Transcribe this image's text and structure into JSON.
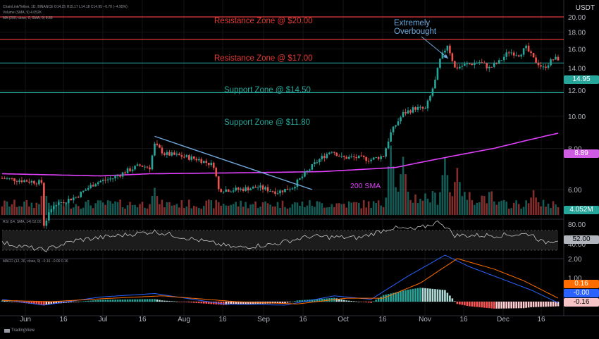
{
  "header": {
    "symbol_line": "ChainLink/Tether, 1D, BINANCE  O14.25  H15.17  L14.18  C14.95  −0.70 (−4.95%)",
    "volume_line": "Volume (SMA, 9)  4.052K",
    "ma_line": "MA (200, close, 0, SMA, 9)  8.89",
    "rsi_line": "RSI (14, SMA, 14)  52.00",
    "macd_line": "MACD (12, 26, close, 9)  −0.16  −0.00  0.16"
  },
  "currency": "USDT",
  "annotations": {
    "resistance_20": "Resistance Zone @ $20.00",
    "resistance_17": "Resistance Zone @ $17.00",
    "support_1450": "Support Zone @ $14.50",
    "support_1180": "Support Zone @ $11.80",
    "overbought_line1": "Extremely",
    "overbought_line2": "Overbought",
    "sma_label": "200 SMA"
  },
  "tags": {
    "price": "14.95",
    "sma": "8.89",
    "volume": "4.052M",
    "rsi": "52.00",
    "macd_signal": "0.16",
    "macd_line": "-0.00",
    "macd_hist": "-0.16"
  },
  "branding": "TradingView",
  "colors": {
    "bull": "#26a69a",
    "bear": "#ef5350",
    "resistance": "#e53935",
    "support": "#26a69a",
    "sma": "#e040fb",
    "trendline": "#6fa8dc",
    "macd": "#2962ff",
    "signal": "#ff6d00"
  },
  "chart_data": {
    "type": "candlestick",
    "price_axis": {
      "ticks": [
        "20.00",
        "18.00",
        "16.00",
        "14.00",
        "12.00",
        "10.00",
        "8.00",
        "6.00"
      ],
      "ylim": [
        4.6,
        21.4
      ],
      "scale": "log"
    },
    "time_axis": {
      "ticks": [
        "Jun",
        "16",
        "Jul",
        "16",
        "Aug",
        "16",
        "Sep",
        "16",
        "Oct",
        "16",
        "Nov",
        "16",
        "Dec",
        "16"
      ]
    },
    "rsi_axis": {
      "ticks": [
        "80.00",
        "40.00"
      ]
    },
    "macd_axis": {
      "ticks": [
        "2.00",
        "1.00"
      ]
    },
    "levels": [
      {
        "name": "Resistance Zone @ $20.00",
        "value": 20.0
      },
      {
        "name": "Resistance Zone @ $17.00",
        "value": 17.1
      },
      {
        "name": "Support Zone @ $14.50",
        "value": 14.5
      },
      {
        "name": "Support Zone @ $11.80",
        "value": 11.8
      }
    ],
    "close_path": [
      [
        0,
        6.5
      ],
      [
        8,
        6.4
      ],
      [
        16,
        6.3
      ],
      [
        17,
        4.7
      ],
      [
        21,
        5.4
      ],
      [
        30,
        5.7
      ],
      [
        38,
        6.3
      ],
      [
        45,
        6.5
      ],
      [
        52,
        6.9
      ],
      [
        56,
        7.1
      ],
      [
        60,
        7.0
      ],
      [
        62,
        8.2
      ],
      [
        66,
        7.7
      ],
      [
        72,
        7.6
      ],
      [
        80,
        7.4
      ],
      [
        86,
        7.1
      ],
      [
        88,
        6.0
      ],
      [
        96,
        6.0
      ],
      [
        104,
        6.1
      ],
      [
        112,
        5.9
      ],
      [
        118,
        6.1
      ],
      [
        124,
        6.8
      ],
      [
        128,
        7.3
      ],
      [
        134,
        7.9
      ],
      [
        138,
        7.5
      ],
      [
        144,
        7.5
      ],
      [
        150,
        7.4
      ],
      [
        155,
        7.6
      ],
      [
        158,
        8.9
      ],
      [
        163,
        10.2
      ],
      [
        168,
        10.6
      ],
      [
        172,
        10.5
      ],
      [
        174,
        11.5
      ],
      [
        176,
        12.8
      ],
      [
        178,
        14.8
      ],
      [
        181,
        16.5
      ],
      [
        184,
        14.0
      ],
      [
        188,
        14.3
      ],
      [
        194,
        14.6
      ],
      [
        198,
        14.0
      ],
      [
        202,
        14.6
      ],
      [
        206,
        15.7
      ],
      [
        210,
        15.4
      ],
      [
        213,
        16.1
      ],
      [
        216,
        14.9
      ],
      [
        220,
        14.0
      ],
      [
        224,
        14.9
      ],
      [
        226,
        14.95
      ]
    ],
    "sma200_path": [
      [
        0,
        6.7
      ],
      [
        40,
        6.6
      ],
      [
        60,
        6.7
      ],
      [
        100,
        6.75
      ],
      [
        130,
        6.8
      ],
      [
        160,
        7.0
      ],
      [
        180,
        7.5
      ],
      [
        200,
        8.0
      ],
      [
        226,
        8.89
      ]
    ],
    "trendline": [
      [
        62,
        8.7
      ],
      [
        126,
        6.0
      ]
    ],
    "volume_spikes": [
      [
        17,
        3.5
      ],
      [
        62,
        3.5
      ],
      [
        158,
        5.6
      ],
      [
        163,
        4.7
      ],
      [
        180,
        4.6
      ],
      [
        185,
        3.8
      ],
      [
        216,
        3.2
      ],
      [
        226,
        1.0
      ]
    ],
    "rsi_path": [
      [
        0,
        45
      ],
      [
        17,
        30
      ],
      [
        30,
        50
      ],
      [
        62,
        68
      ],
      [
        80,
        50
      ],
      [
        95,
        35
      ],
      [
        110,
        42
      ],
      [
        125,
        58
      ],
      [
        145,
        55
      ],
      [
        158,
        75
      ],
      [
        168,
        72
      ],
      [
        178,
        88
      ],
      [
        184,
        60
      ],
      [
        200,
        60
      ],
      [
        215,
        63
      ],
      [
        220,
        45
      ],
      [
        226,
        52
      ]
    ],
    "macd_line_path": [
      [
        0,
        0.1
      ],
      [
        17,
        -0.15
      ],
      [
        40,
        0.2
      ],
      [
        62,
        0.35
      ],
      [
        90,
        -0.1
      ],
      [
        115,
        -0.15
      ],
      [
        135,
        0.25
      ],
      [
        150,
        0.1
      ],
      [
        165,
        1.1
      ],
      [
        180,
        2.0
      ],
      [
        190,
        1.5
      ],
      [
        205,
        0.9
      ],
      [
        215,
        0.5
      ],
      [
        226,
        -0.05
      ]
    ],
    "macd_signal_path": [
      [
        0,
        0.05
      ],
      [
        20,
        0.0
      ],
      [
        45,
        0.15
      ],
      [
        65,
        0.25
      ],
      [
        95,
        0.0
      ],
      [
        120,
        -0.1
      ],
      [
        140,
        0.15
      ],
      [
        155,
        0.15
      ],
      [
        170,
        0.8
      ],
      [
        185,
        1.85
      ],
      [
        200,
        1.4
      ],
      [
        212,
        0.9
      ],
      [
        226,
        0.15
      ]
    ]
  }
}
